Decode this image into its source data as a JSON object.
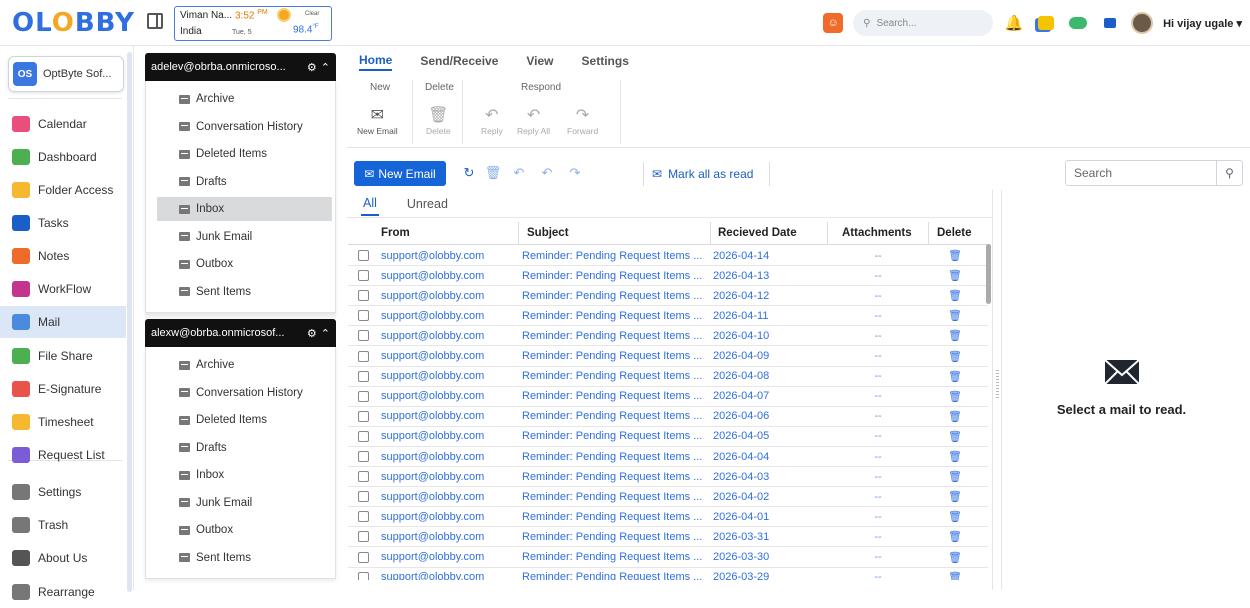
{
  "app": {
    "logo": "OLOBBY"
  },
  "weather": {
    "location": "Viman Na...",
    "time": "3:52",
    "ampm": "PM",
    "condition": "Clear",
    "country": "India",
    "day": "Tue, 5",
    "temp": "98.4",
    "unit": "°F"
  },
  "header": {
    "search_placeholder": "Search...",
    "user_greeting": "Hi vijay ugale ▾"
  },
  "org": {
    "badge": "OS",
    "name": "OptByte Sof..."
  },
  "sidebar": {
    "items": [
      {
        "label": "Calendar",
        "icon": "calendar-icon",
        "color": "#e94f7c"
      },
      {
        "label": "Dashboard",
        "icon": "dashboard-icon",
        "color": "#4caf50"
      },
      {
        "label": "Folder Access",
        "icon": "folder-icon",
        "color": "#f5b82e"
      },
      {
        "label": "Tasks",
        "icon": "checkbox-icon",
        "color": "#1a5fc7"
      },
      {
        "label": "Notes",
        "icon": "notes-icon",
        "color": "#f06a2a"
      },
      {
        "label": "WorkFlow",
        "icon": "workflow-icon",
        "color": "#c2348f"
      },
      {
        "label": "Mail",
        "icon": "mail-icon",
        "color": "#4a8be0"
      },
      {
        "label": "File Share",
        "icon": "file-share-icon",
        "color": "#4caf50"
      },
      {
        "label": "E-Signature",
        "icon": "signature-icon",
        "color": "#e9544a"
      },
      {
        "label": "Timesheet",
        "icon": "timesheet-icon",
        "color": "#f5b82e"
      },
      {
        "label": "Request List",
        "icon": "request-list-icon",
        "color": "#7b5cd6"
      },
      {
        "label": "Settings",
        "icon": "settings-icon",
        "color": "#777"
      },
      {
        "label": "Trash",
        "icon": "trash-icon",
        "color": "#777"
      },
      {
        "label": "About Us",
        "icon": "info-icon",
        "color": "#555"
      },
      {
        "label": "Rearrange",
        "icon": "rearrange-icon",
        "color": "#777"
      }
    ]
  },
  "accounts": [
    {
      "email": "adelev@obrba.onmicroso...",
      "folders": [
        "Archive",
        "Conversation History",
        "Deleted Items",
        "Drafts",
        "Inbox",
        "Junk Email",
        "Outbox",
        "Sent Items"
      ],
      "active": "Inbox"
    },
    {
      "email": "alexw@obrba.onmicrosof...",
      "folders": [
        "Archive",
        "Conversation History",
        "Deleted Items",
        "Drafts",
        "Inbox",
        "Junk Email",
        "Outbox",
        "Sent Items"
      ],
      "active": ""
    }
  ],
  "ribbon": {
    "tabs": [
      "Home",
      "Send/Receive",
      "View",
      "Settings"
    ],
    "groups": {
      "new": "New",
      "delete": "Delete",
      "respond": "Respond"
    },
    "buttons": {
      "new_email": "New Email",
      "delete": "Delete",
      "reply": "Reply",
      "reply_all": "Reply All",
      "forward": "Forward"
    }
  },
  "toolbar": {
    "new_email": "New Email",
    "mark_all_read": "Mark all as read",
    "search_placeholder": "Search"
  },
  "filters": [
    "All",
    "Unread"
  ],
  "table": {
    "columns": [
      "From",
      "Subject",
      "Recieved Date",
      "Attachments",
      "Delete"
    ],
    "rows": [
      {
        "from": "support@olobby.com",
        "subject": "Reminder: Pending Request Items ...",
        "date": "2026-04-14",
        "att": "--"
      },
      {
        "from": "support@olobby.com",
        "subject": "Reminder: Pending Request Items ...",
        "date": "2026-04-13",
        "att": "--"
      },
      {
        "from": "support@olobby.com",
        "subject": "Reminder: Pending Request Items ...",
        "date": "2026-04-12",
        "att": "--"
      },
      {
        "from": "support@olobby.com",
        "subject": "Reminder: Pending Request Items ...",
        "date": "2026-04-11",
        "att": "--"
      },
      {
        "from": "support@olobby.com",
        "subject": "Reminder: Pending Request Items ...",
        "date": "2026-04-10",
        "att": "--"
      },
      {
        "from": "support@olobby.com",
        "subject": "Reminder: Pending Request Items ...",
        "date": "2026-04-09",
        "att": "--"
      },
      {
        "from": "support@olobby.com",
        "subject": "Reminder: Pending Request Items ...",
        "date": "2026-04-08",
        "att": "--"
      },
      {
        "from": "support@olobby.com",
        "subject": "Reminder: Pending Request Items ...",
        "date": "2026-04-07",
        "att": "--"
      },
      {
        "from": "support@olobby.com",
        "subject": "Reminder: Pending Request Items ...",
        "date": "2026-04-06",
        "att": "--"
      },
      {
        "from": "support@olobby.com",
        "subject": "Reminder: Pending Request Items ...",
        "date": "2026-04-05",
        "att": "--"
      },
      {
        "from": "support@olobby.com",
        "subject": "Reminder: Pending Request Items ...",
        "date": "2026-04-04",
        "att": "--"
      },
      {
        "from": "support@olobby.com",
        "subject": "Reminder: Pending Request Items ...",
        "date": "2026-04-03",
        "att": "--"
      },
      {
        "from": "support@olobby.com",
        "subject": "Reminder: Pending Request Items ...",
        "date": "2026-04-02",
        "att": "--"
      },
      {
        "from": "support@olobby.com",
        "subject": "Reminder: Pending Request Items ...",
        "date": "2026-04-01",
        "att": "--"
      },
      {
        "from": "support@olobby.com",
        "subject": "Reminder: Pending Request Items ...",
        "date": "2026-03-31",
        "att": "--"
      },
      {
        "from": "support@olobby.com",
        "subject": "Reminder: Pending Request Items ...",
        "date": "2026-03-30",
        "att": "--"
      },
      {
        "from": "support@olobby.com",
        "subject": "Reminder: Pending Request Items ...",
        "date": "2026-03-29",
        "att": "--"
      }
    ]
  },
  "reader": {
    "empty_message": "Select a mail to read."
  },
  "colors": {
    "accent": "#1a5fc7",
    "active_nav": "#dbe6f7",
    "account_header": "#111111"
  }
}
